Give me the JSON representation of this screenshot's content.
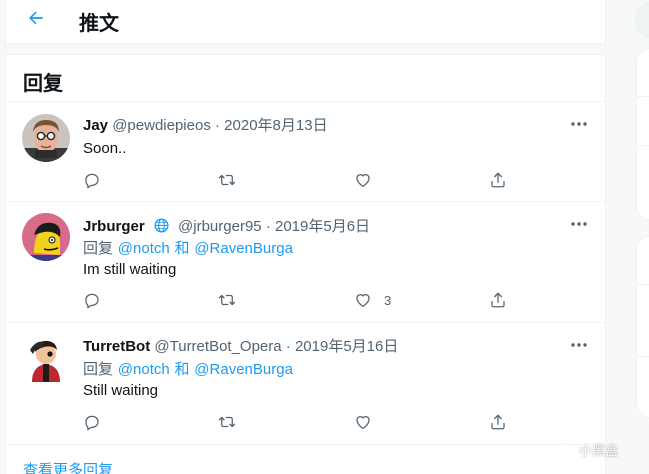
{
  "header": {
    "title": "推文"
  },
  "section": {
    "title": "回复"
  },
  "tweets": [
    {
      "name": "Jay",
      "handle": "@pewdiepieos",
      "separator": "·",
      "date": "2020年8月13日",
      "text": "Soon..",
      "like_count": ""
    },
    {
      "name": "Jrburger",
      "handle": "@jrburger95",
      "separator": "·",
      "date": "2019年5月6日",
      "reply_prefix": "回复",
      "mention1": "@notch",
      "conj": "和",
      "mention2": "@RavenBurga",
      "text": "Im still waiting",
      "like_count": "3"
    },
    {
      "name": "TurretBot",
      "handle": "@TurretBot_Opera",
      "separator": "·",
      "date": "2019年5月16日",
      "reply_prefix": "回复",
      "mention1": "@notch",
      "conj": "和",
      "mention2": "@RavenBurga",
      "text": "Still waiting",
      "like_count": ""
    }
  ],
  "show_more": "查看更多回复",
  "watermark": "小黑盒",
  "colors": {
    "accent": "#1d9bf0",
    "secondary_text": "#536471",
    "border": "#eff3f4"
  },
  "icons": [
    "back-arrow-icon",
    "more-dots-icon",
    "reply-icon",
    "retweet-icon",
    "like-icon",
    "share-icon",
    "globe-icon"
  ]
}
